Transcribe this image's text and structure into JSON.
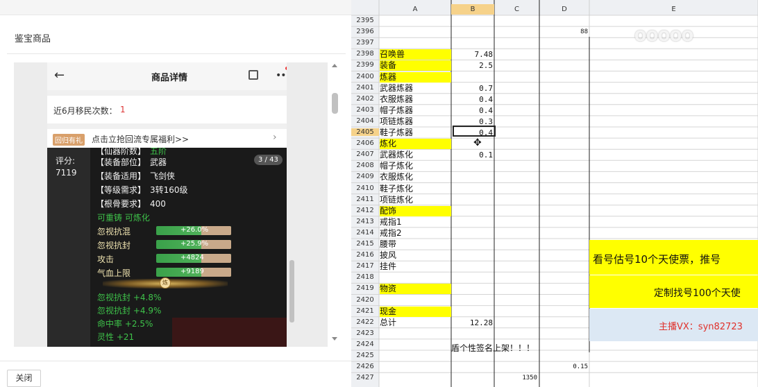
{
  "dialog": {
    "title": "鉴宝商品",
    "close_label": "关闭"
  },
  "phone": {
    "header_title": "商品详情",
    "back_icon": "←",
    "more_icon": "•••",
    "migrate_label": "近6月移民次数：",
    "migrate_value": "1",
    "promo_tag": "回归有礼",
    "promo_text": "点击立抢回流专属福利>>",
    "promo_arrow": "›",
    "score_label": "评分:",
    "score_value": "7119",
    "image_counter": "3 / 43",
    "attributes": [
      {
        "label": "【仙器阶数】",
        "value": "五阶"
      },
      {
        "label": "【装备部位】",
        "value": "武器"
      },
      {
        "label": "【装备适用】",
        "value": "飞剑侠"
      },
      {
        "label": "【等级需求】",
        "value": "3转160级"
      },
      {
        "label": "【根骨要求】",
        "value": "400"
      }
    ],
    "reforge_text": "可重铸 可炼化",
    "bars": [
      {
        "name": "忽视抗混",
        "value": "+26.0%",
        "level": 0.52
      },
      {
        "name": "忽视抗封",
        "value": "+25.9%",
        "level": 0.52
      },
      {
        "name": "攻击",
        "value": "+4824",
        "level": 0.52
      },
      {
        "name": "气血上限",
        "value": "+9189",
        "level": 0.52
      }
    ],
    "divider_badge": "炼",
    "green_stats": [
      "忽视抗封 +4.8%",
      "忽视抗封 +4.9%",
      "命中率 +2.5%",
      "灵性 +21"
    ]
  },
  "sheet": {
    "columns": [
      "A",
      "B",
      "C",
      "D",
      "E"
    ],
    "rows": [
      {
        "n": "2395",
        "a": "",
        "b": "",
        "d": ""
      },
      {
        "n": "2396",
        "a": "",
        "b": "",
        "d": "88"
      },
      {
        "n": "2397",
        "a": "",
        "b": "",
        "d": ""
      },
      {
        "n": "2398",
        "a": "召唤兽",
        "b": "7.48",
        "d": "",
        "hl": true
      },
      {
        "n": "2399",
        "a": "装备",
        "b": "2.5",
        "d": "",
        "hl": true
      },
      {
        "n": "2400",
        "a": "炼器",
        "b": "",
        "d": "",
        "hl": true
      },
      {
        "n": "2401",
        "a": "武器炼器",
        "b": "0.7",
        "d": ""
      },
      {
        "n": "2402",
        "a": "衣服炼器",
        "b": "0.4",
        "d": ""
      },
      {
        "n": "2403",
        "a": "帽子炼器",
        "b": "0.4",
        "d": ""
      },
      {
        "n": "2404",
        "a": "项链炼器",
        "b": "0.3",
        "d": ""
      },
      {
        "n": "2405",
        "a": "鞋子炼器",
        "b": "0.4",
        "d": "",
        "active": true
      },
      {
        "n": "2406",
        "a": "炼化",
        "b": "",
        "d": "",
        "hl": true
      },
      {
        "n": "2407",
        "a": "武器炼化",
        "b": "0.1",
        "d": ""
      },
      {
        "n": "2408",
        "a": "帽子炼化",
        "b": "",
        "d": ""
      },
      {
        "n": "2409",
        "a": "衣服炼化",
        "b": "",
        "d": ""
      },
      {
        "n": "2410",
        "a": "鞋子炼化",
        "b": "",
        "d": ""
      },
      {
        "n": "2411",
        "a": "项链炼化",
        "b": "",
        "d": ""
      },
      {
        "n": "2412",
        "a": "配饰",
        "b": "",
        "d": "",
        "hl": true
      },
      {
        "n": "2413",
        "a": "戒指1",
        "b": "",
        "d": ""
      },
      {
        "n": "2414",
        "a": "戒指2",
        "b": "",
        "d": ""
      },
      {
        "n": "2415",
        "a": "腰带",
        "b": "",
        "d": ""
      },
      {
        "n": "2416",
        "a": "披风",
        "b": "",
        "d": ""
      },
      {
        "n": "2417",
        "a": "挂件",
        "b": "",
        "d": ""
      },
      {
        "n": "2418",
        "a": "",
        "b": "",
        "d": ""
      },
      {
        "n": "2419",
        "a": "物资",
        "b": "",
        "d": "",
        "hl": true
      },
      {
        "n": "2420",
        "a": "",
        "b": "",
        "d": ""
      },
      {
        "n": "2421",
        "a": "现金",
        "b": "",
        "d": "",
        "hl": true
      },
      {
        "n": "2422",
        "a": "总计",
        "b": "12.28",
        "d": ""
      },
      {
        "n": "2423",
        "a": "",
        "b": "",
        "d": ""
      },
      {
        "n": "2424",
        "a": "",
        "b": "",
        "d": ""
      },
      {
        "n": "2425",
        "a": "",
        "b": "",
        "d": ""
      },
      {
        "n": "2426",
        "a": "",
        "b": "",
        "d": "0.15"
      },
      {
        "n": "2427",
        "a": "",
        "b": "",
        "c": "1350",
        "d": ""
      }
    ],
    "banner1": "看号估号10个天使票，推号",
    "banner2": "定制找号100个天使",
    "banner3": "主播VX：syn82723",
    "signature_note": "盾个性签名上架！！！",
    "cursor_icon": "✥",
    "watermark": "OOOOO",
    "colors": {
      "highlight": "#ffff00",
      "banner_blue": "#dce8f4",
      "banner_red_text": "#e0302a"
    }
  }
}
